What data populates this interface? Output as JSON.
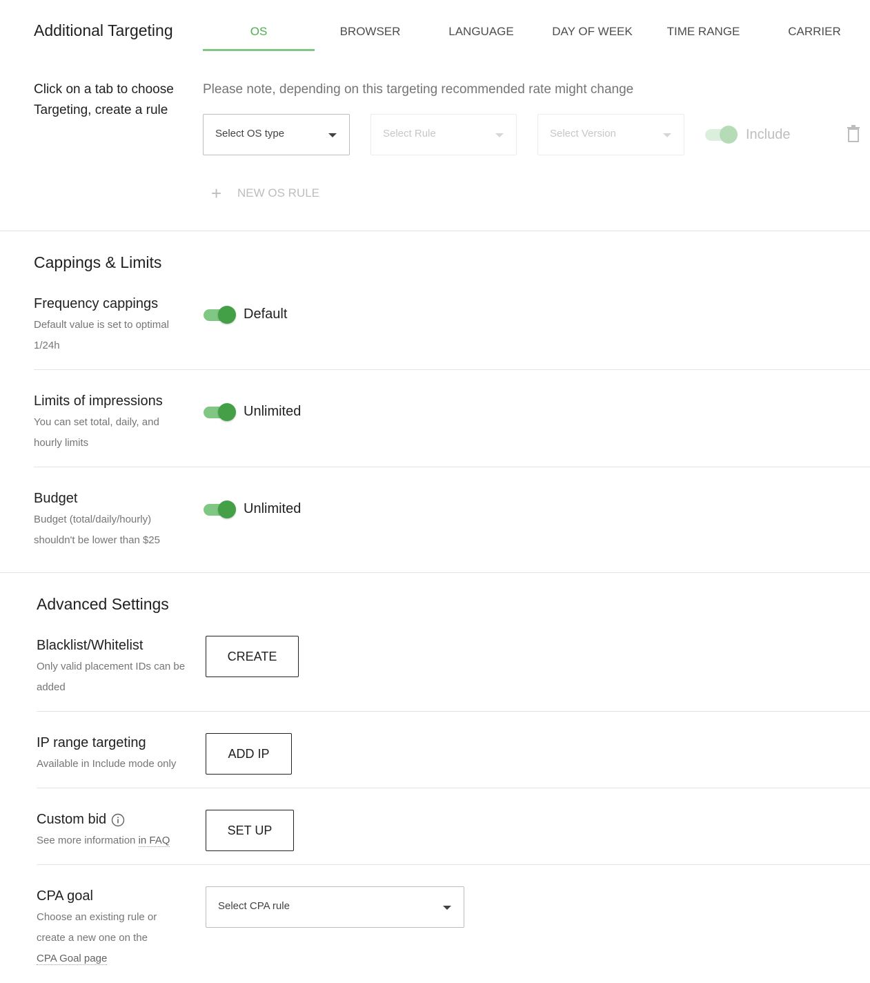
{
  "targeting": {
    "title": "Additional Targeting",
    "tabs": [
      {
        "label": "OS"
      },
      {
        "label": "BROWSER"
      },
      {
        "label": "LANGUAGE"
      },
      {
        "label": "DAY OF WEEK"
      },
      {
        "label": "TIME RANGE"
      },
      {
        "label": "CARRIER"
      }
    ],
    "active_tab": "OS",
    "hint_line1": "Click on a tab to choose",
    "hint_line2": "Targeting, create a rule",
    "note": "Please note, depending on this targeting recommended rate might change",
    "os_select_placeholder": "Select OS type",
    "rule_select_placeholder": "Select Rule",
    "version_select_placeholder": "Select Version",
    "include_label": "Include",
    "include_enabled": true,
    "new_rule_label": "NEW OS RULE"
  },
  "cappings": {
    "title": "Cappings & Limits",
    "items": [
      {
        "title": "Frequency cappings",
        "desc_line1": "Default value is set to optimal",
        "desc_line2": "1/24h",
        "toggle_label": "Default",
        "toggle_on": true
      },
      {
        "title": "Limits of impressions",
        "desc_line1": "You can set total, daily, and",
        "desc_line2": "hourly limits",
        "toggle_label": "Unlimited",
        "toggle_on": true
      },
      {
        "title": "Budget",
        "desc_line1": "Budget (total/daily/hourly)",
        "desc_line2": "shouldn't be lower than $25",
        "toggle_label": "Unlimited",
        "toggle_on": true
      }
    ]
  },
  "advanced": {
    "title": "Advanced Settings",
    "blacklist": {
      "title": "Blacklist/Whitelist",
      "desc_line1": "Only valid placement IDs can be",
      "desc_line2": "added",
      "button": "CREATE"
    },
    "ip_range": {
      "title": "IP range targeting",
      "desc": "Available in Include mode only",
      "button": "ADD IP"
    },
    "custom_bid": {
      "title": "Custom bid",
      "desc_prefix": "See more information ",
      "desc_link": "in FAQ",
      "button": "SET UP"
    },
    "cpa_goal": {
      "title": "CPA goal",
      "desc_line1": "Choose an existing rule or",
      "desc_line2": "create a new one on the",
      "desc_link": "CPA Goal page",
      "select_placeholder": "Select CPA rule"
    }
  },
  "colors": {
    "accent": "#4caf50",
    "toggle_track": "#81c784",
    "toggle_thumb": "#43a047"
  }
}
